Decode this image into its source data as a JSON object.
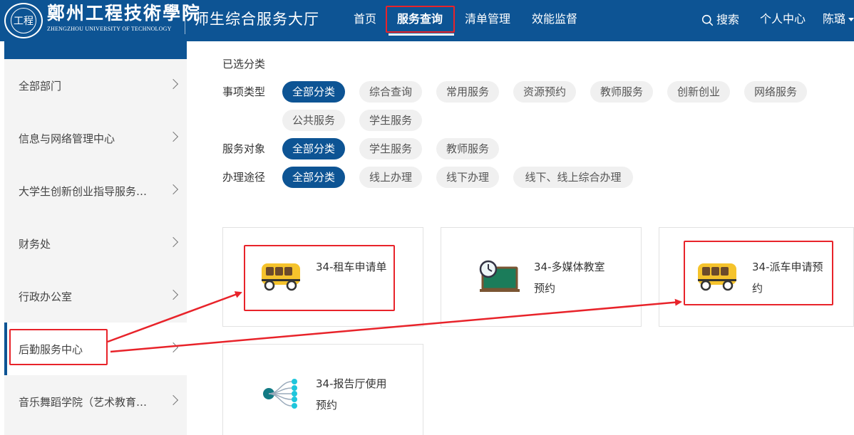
{
  "header": {
    "logo_cn": "鄭州工程技術學院",
    "logo_en": "ZHENGZHOU UNIVERSITY OF TECHNOLOGY",
    "logo_emblem_text": "工程",
    "site_title": "师生综合服务大厅",
    "nav": {
      "home": "首页",
      "service_query": "服务查询",
      "list_management": "清单管理",
      "efficiency_monitor": "效能监督"
    },
    "search_label": "搜索",
    "personal_center": "个人中心",
    "user_name": "陈璐"
  },
  "sidebar": {
    "items": [
      {
        "label": "全部部门"
      },
      {
        "label": "信息与网络管理中心"
      },
      {
        "label": "大学生创新创业指导服务中心"
      },
      {
        "label": "财务处"
      },
      {
        "label": "行政办公室"
      },
      {
        "label": "后勤服务中心"
      },
      {
        "label": "音乐舞蹈学院（艺术教育中心）"
      }
    ],
    "active_index": 5
  },
  "filters": {
    "selected_label": "已选分类",
    "item_type": {
      "label": "事项类型",
      "options": [
        "全部分类",
        "综合查询",
        "常用服务",
        "资源预约",
        "教师服务",
        "创新创业",
        "网络服务",
        "公共服务",
        "学生服务"
      ]
    },
    "service_target": {
      "label": "服务对象",
      "options": [
        "全部分类",
        "学生服务",
        "教师服务"
      ]
    },
    "handling_method": {
      "label": "办理途径",
      "options": [
        "全部分类",
        "线上办理",
        "线下办理",
        "线下、线上综合办理"
      ]
    }
  },
  "cards": [
    {
      "title": "34-租车申请单",
      "icon": "bus-icon"
    },
    {
      "title": "34-多媒体教室预约",
      "icon": "classroom-clock-icon"
    },
    {
      "title": "34-派车申请预约",
      "icon": "bus-icon"
    },
    {
      "title": "34-报告厅使用预约",
      "icon": "distribution-icon"
    }
  ],
  "colors": {
    "primary": "#0d5494",
    "highlight_red": "#e8232a",
    "chip_bg": "#f0f0f0",
    "sidebar_bg": "#f4f4f4"
  }
}
